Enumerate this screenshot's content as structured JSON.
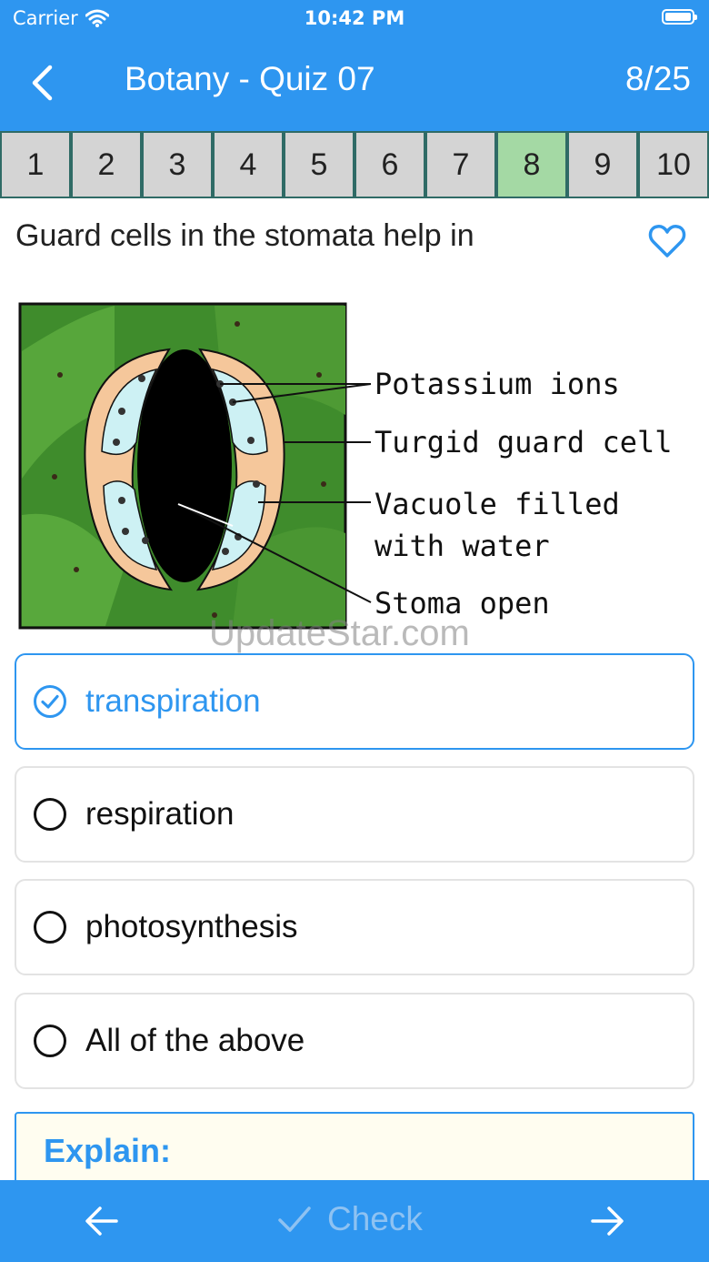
{
  "status_bar": {
    "carrier": "Carrier",
    "time": "10:42 PM"
  },
  "header": {
    "title": "Botany - Quiz 07",
    "progress": "8/25",
    "back_icon": "chevron-left-icon"
  },
  "question_nav": {
    "items": [
      "1",
      "2",
      "3",
      "4",
      "5",
      "6",
      "7",
      "8",
      "9",
      "10"
    ],
    "active_index": 7,
    "active_color": "#a4d9a4"
  },
  "question": {
    "text": "Guard cells in the stomata help in",
    "favorite_icon": "heart-outline-icon"
  },
  "figure": {
    "labels": [
      "Potassium ions",
      "Turgid guard cell",
      "Vacuole filled",
      "with water",
      "Stoma open"
    ]
  },
  "watermark": "UpdateStar.com",
  "options": [
    {
      "label": "transpiration",
      "selected": true
    },
    {
      "label": "respiration",
      "selected": false
    },
    {
      "label": "photosynthesis",
      "selected": false
    },
    {
      "label": "All of the above",
      "selected": false
    }
  ],
  "explain": {
    "title": "Explain:"
  },
  "bottom_bar": {
    "check_label": "Check",
    "prev_icon": "arrow-left-icon",
    "next_icon": "arrow-right-icon"
  },
  "colors": {
    "accent": "#2e96f0",
    "nav_cell": "#d4d4d4",
    "nav_border": "#2f6b66"
  }
}
